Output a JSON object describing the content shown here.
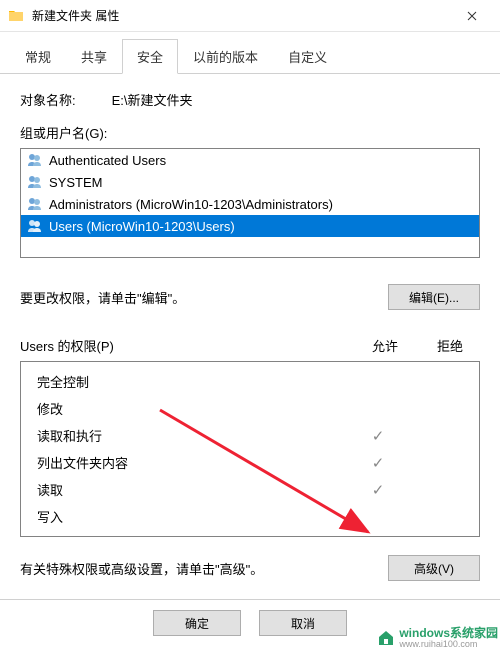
{
  "titlebar": {
    "title": "新建文件夹 属性"
  },
  "tabs": [
    {
      "label": "常规"
    },
    {
      "label": "共享"
    },
    {
      "label": "安全"
    },
    {
      "label": "以前的版本"
    },
    {
      "label": "自定义"
    }
  ],
  "object": {
    "label": "对象名称:",
    "value": "E:\\新建文件夹"
  },
  "groups": {
    "label": "组或用户名(G):",
    "items": [
      {
        "name": "Authenticated Users"
      },
      {
        "name": "SYSTEM"
      },
      {
        "name": "Administrators (MicroWin10-1203\\Administrators)"
      },
      {
        "name": "Users (MicroWin10-1203\\Users)"
      }
    ]
  },
  "edit": {
    "hint": "要更改权限，请单击\"编辑\"。",
    "button": "编辑(E)..."
  },
  "perms": {
    "header_label": "Users 的权限(P)",
    "allow": "允许",
    "deny": "拒绝",
    "items": [
      {
        "name": "完全控制",
        "allow": "",
        "deny": ""
      },
      {
        "name": "修改",
        "allow": "",
        "deny": ""
      },
      {
        "name": "读取和执行",
        "allow": "✓",
        "deny": ""
      },
      {
        "name": "列出文件夹内容",
        "allow": "✓",
        "deny": ""
      },
      {
        "name": "读取",
        "allow": "✓",
        "deny": ""
      },
      {
        "name": "写入",
        "allow": "",
        "deny": ""
      }
    ]
  },
  "advanced": {
    "hint": "有关特殊权限或高级设置，请单击\"高级\"。",
    "button": "高级(V)"
  },
  "footer": {
    "ok": "确定",
    "cancel": "取消"
  },
  "watermark": {
    "line1": "windows系统家园",
    "line2": "www.ruihai100.com"
  }
}
